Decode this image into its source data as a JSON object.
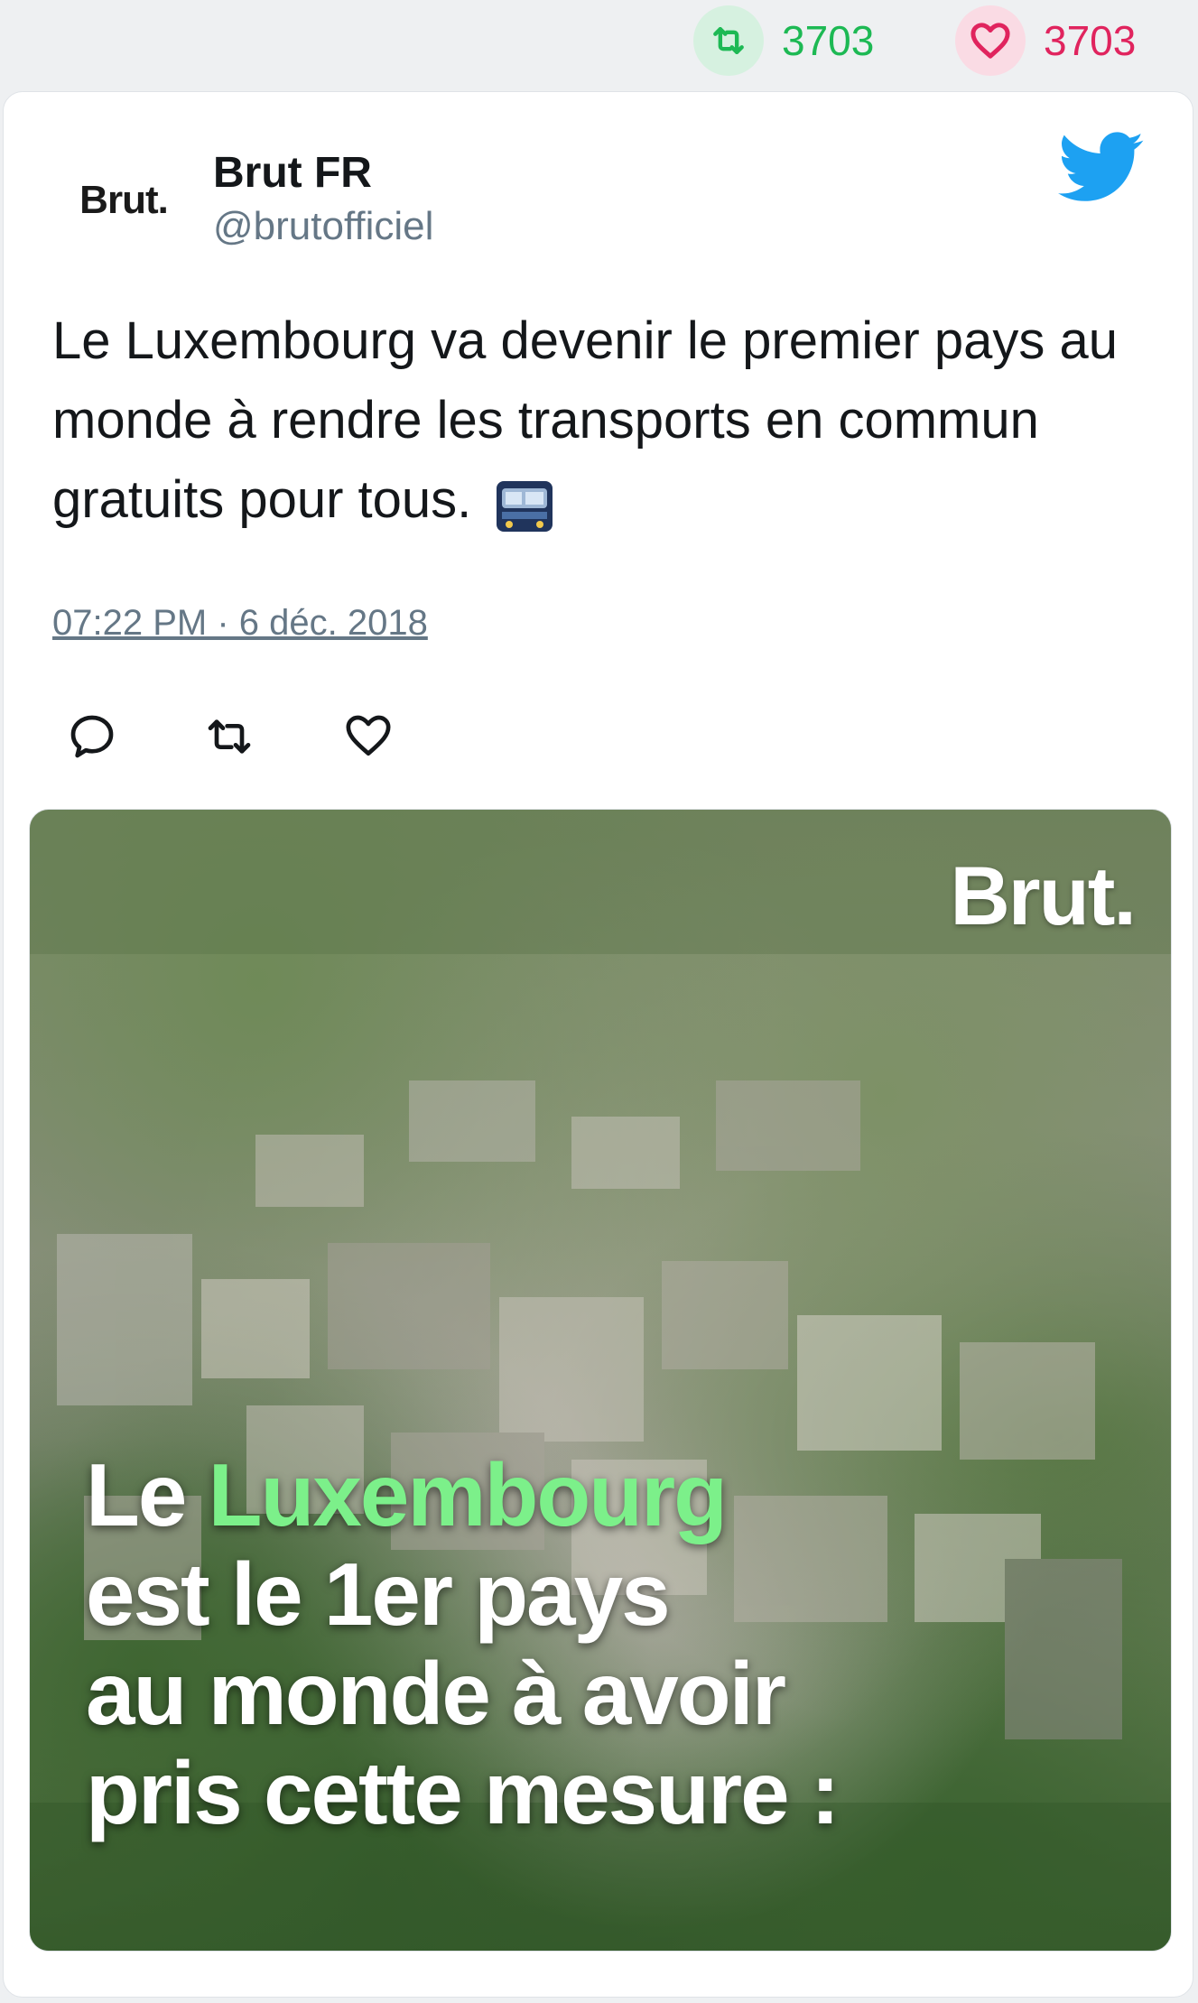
{
  "top_stats": {
    "retweet_count": "3703",
    "like_count": "3703",
    "retweet_icon": "retweet-icon",
    "like_icon": "heart-icon"
  },
  "tweet": {
    "avatar_text": "Brut.",
    "display_name": "Brut FR",
    "handle": "@brutofficiel",
    "text": "Le Luxembourg va devenir le premier pays au monde à rendre les transports en commun gratuits pour tous.",
    "text_emoji": "tram-icon",
    "timestamp": "07:22 PM · 6 déc. 2018",
    "brand_icon": "twitter-bird-icon",
    "actions": [
      "reply-icon",
      "retweet-icon",
      "like-icon"
    ]
  },
  "media": {
    "logo": "Brut.",
    "caption_line1_prefix": "Le ",
    "caption_line1_highlight": "Luxembourg",
    "caption_line2": "est le 1er pays",
    "caption_line3": "au monde à avoir",
    "caption_line4": "pris cette mesure :"
  },
  "colors": {
    "retweet": "#1db954",
    "like": "#e0245e",
    "twitter_blue": "#1da1f2",
    "highlight_green": "#7cf08a"
  }
}
